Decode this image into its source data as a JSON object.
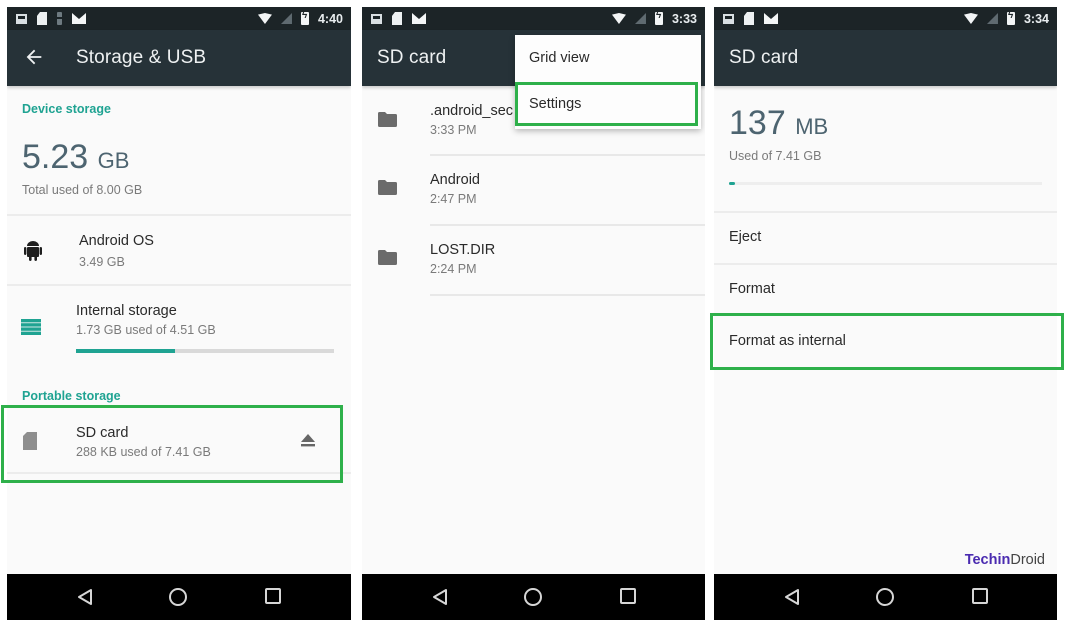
{
  "screens": [
    {
      "status_bar": {
        "time": "4:40",
        "left_icons": [
          "picture-icon",
          "sd-card-icon",
          "usb-icon",
          "gmail-icon"
        ],
        "right_icons": [
          "wifi-icon",
          "no-signal-icon",
          "battery-charging-icon"
        ]
      },
      "app_bar": {
        "title": "Storage & USB",
        "back_icon": "arrow-left-icon"
      },
      "device_storage": {
        "header": "Device storage",
        "value": "5.23",
        "unit": "GB",
        "caption": "Total used of 8.00 GB"
      },
      "items": [
        {
          "icon": "android-icon",
          "title": "Android OS",
          "subtitle": "3.49 GB"
        },
        {
          "icon": "storage-list-icon",
          "title": "Internal storage",
          "subtitle": "1.73 GB used of 4.51 GB",
          "progress_fraction": 0.384
        }
      ],
      "portable_storage": {
        "header": "Portable storage",
        "item": {
          "icon": "sd-card-icon",
          "title": "SD card",
          "subtitle": "288 KB used of 7.41 GB",
          "action_icon": "eject-icon",
          "highlighted": true
        }
      }
    },
    {
      "status_bar": {
        "time": "3:33",
        "left_icons": [
          "picture-icon",
          "sd-card-icon",
          "gmail-icon"
        ],
        "right_icons": [
          "wifi-icon",
          "no-signal-icon",
          "battery-charging-icon"
        ]
      },
      "app_bar": {
        "title": "SD card"
      },
      "overflow_menu": {
        "items": [
          {
            "label": "Grid view",
            "highlighted": false
          },
          {
            "label": "Settings",
            "highlighted": true
          }
        ]
      },
      "files": [
        {
          "icon": "folder-icon",
          "name": ".android_secure",
          "name_visible": ".android_sec",
          "time": "3:33 PM"
        },
        {
          "icon": "folder-icon",
          "name": "Android",
          "time": "2:47 PM"
        },
        {
          "icon": "folder-icon",
          "name": "LOST.DIR",
          "time": "2:24 PM"
        }
      ]
    },
    {
      "status_bar": {
        "time": "3:34",
        "left_icons": [
          "picture-icon",
          "sd-card-icon",
          "gmail-icon"
        ],
        "right_icons": [
          "wifi-icon",
          "no-signal-icon",
          "battery-charging-icon"
        ]
      },
      "app_bar": {
        "title": "SD card"
      },
      "usage": {
        "value": "137",
        "unit": "MB",
        "caption": "Used of 7.41 GB",
        "progress_fraction": 0.018
      },
      "options": [
        {
          "label": "Eject",
          "highlighted": false
        },
        {
          "label": "Format",
          "highlighted": false
        },
        {
          "label": "Format as internal",
          "highlighted": true
        }
      ]
    }
  ],
  "nav_bar": {
    "buttons": [
      "back-icon",
      "home-icon",
      "recents-icon"
    ]
  },
  "watermark": {
    "part1": "Techin",
    "part2": "Droid"
  },
  "colors": {
    "accent": "#1fa392",
    "highlight_box": "#2eb04a",
    "app_bar": "#263238",
    "status_bar": "#1c2427",
    "watermark": "#4a2bb0"
  }
}
